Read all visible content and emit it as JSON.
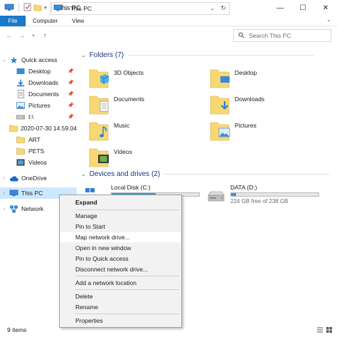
{
  "window": {
    "title": "This PC",
    "controls": {
      "minimize": "—",
      "maximize": "☐",
      "close": "✕"
    }
  },
  "ribbon": {
    "tabs": [
      "File",
      "Computer",
      "View"
    ]
  },
  "address": {
    "crumb": "This PC",
    "separator": "›",
    "search_placeholder": "Search This PC"
  },
  "sidebar": {
    "quick_access": "Quick access",
    "items": [
      {
        "label": "Desktop",
        "icon": "desktop-icon",
        "pinned": true
      },
      {
        "label": "Downloads",
        "icon": "download-folder-icon",
        "pinned": true
      },
      {
        "label": "Documents",
        "icon": "documents-icon",
        "pinned": true
      },
      {
        "label": "Pictures",
        "icon": "pictures-icon",
        "pinned": true
      },
      {
        "label": "I:\\",
        "icon": "drive-icon",
        "pinned": true
      },
      {
        "label": "2020-07-30 14.59.04",
        "icon": "folder-icon",
        "pinned": false
      },
      {
        "label": "ART",
        "icon": "folder-icon",
        "pinned": false
      },
      {
        "label": "PETS",
        "icon": "folder-icon",
        "pinned": false
      },
      {
        "label": "Videos",
        "icon": "videos-icon",
        "pinned": false
      }
    ],
    "onedrive": "OneDrive",
    "this_pc": "This PC",
    "network": "Network"
  },
  "content": {
    "folders_header": "Folders (7)",
    "folders": [
      "3D Objects",
      "Desktop",
      "Documents",
      "Downloads",
      "Music",
      "Pictures",
      "Videos"
    ],
    "drives_header": "Devices and drives (2)",
    "drives": [
      {
        "name": "Local Disk (C:)",
        "used_fraction": 0.5
      },
      {
        "name": "DATA (D:)",
        "free_text": "224 GB free of 238 GB",
        "used_fraction": 0.06
      }
    ]
  },
  "context_menu": {
    "items": [
      "Expand",
      "Manage",
      "Pin to Start",
      "Map network drive...",
      "Open in new window",
      "Pin to Quick access",
      "Disconnect network drive...",
      "Add a network location",
      "Delete",
      "Rename",
      "Properties"
    ]
  },
  "status": {
    "count": "9 items"
  },
  "colors": {
    "accent": "#1979ca",
    "selection": "#cce8ff",
    "header_text": "#1e3287",
    "drive_fill": "#26a0da",
    "folder_yellow": "#f8d775"
  }
}
